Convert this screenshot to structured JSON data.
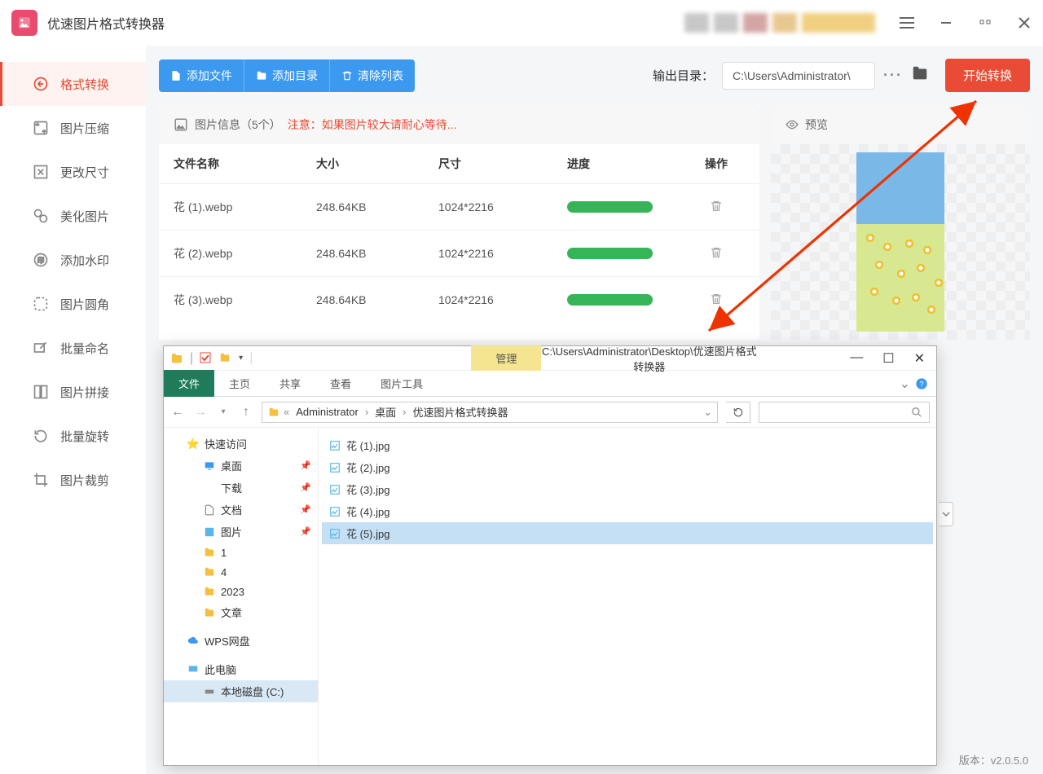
{
  "app": {
    "title": "优速图片格式转换器"
  },
  "sidebar": {
    "items": [
      {
        "label": "格式转换"
      },
      {
        "label": "图片压缩"
      },
      {
        "label": "更改尺寸"
      },
      {
        "label": "美化图片"
      },
      {
        "label": "添加水印"
      },
      {
        "label": "图片圆角"
      },
      {
        "label": "批量命名"
      },
      {
        "label": "图片拼接"
      },
      {
        "label": "批量旋转"
      },
      {
        "label": "图片裁剪"
      }
    ]
  },
  "toolbar": {
    "add_file": "添加文件",
    "add_dir": "添加目录",
    "clear": "清除列表",
    "output_label": "输出目录：",
    "output_path": "C:\\Users\\Administrator\\",
    "start": "开始转换"
  },
  "info": {
    "label": "图片信息（5个）",
    "warn": "注意：如果图片较大请耐心等待..."
  },
  "table": {
    "cols": {
      "name": "文件名称",
      "size": "大小",
      "dim": "尺寸",
      "prog": "进度",
      "op": "操作"
    },
    "rows": [
      {
        "name": "花 (1).webp",
        "size": "248.64KB",
        "dim": "1024*2216"
      },
      {
        "name": "花 (2).webp",
        "size": "248.64KB",
        "dim": "1024*2216"
      },
      {
        "name": "花 (3).webp",
        "size": "248.64KB",
        "dim": "1024*2216"
      }
    ]
  },
  "preview": {
    "label": "预览"
  },
  "version": "版本：v2.0.5.0",
  "explorer": {
    "manage": "管理",
    "title_path": "C:\\Users\\Administrator\\Desktop\\优速图片格式转换器",
    "tabs": {
      "file": "文件",
      "home": "主页",
      "share": "共享",
      "view": "查看",
      "pic_tools": "图片工具"
    },
    "breadcrumb": [
      "Administrator",
      "桌面",
      "优速图片格式转换器"
    ],
    "tree": {
      "quick": "快速访问",
      "desktop": "桌面",
      "downloads": "下载",
      "documents": "文档",
      "pictures": "图片",
      "f1": "1",
      "f4": "4",
      "f2023": "2023",
      "farticle": "文章",
      "wps": "WPS网盘",
      "thispc": "此电脑",
      "localc": "本地磁盘 (C:)"
    },
    "files": [
      {
        "name": "花 (1).jpg"
      },
      {
        "name": "花 (2).jpg"
      },
      {
        "name": "花 (3).jpg"
      },
      {
        "name": "花 (4).jpg"
      },
      {
        "name": "花 (5).jpg"
      }
    ]
  }
}
